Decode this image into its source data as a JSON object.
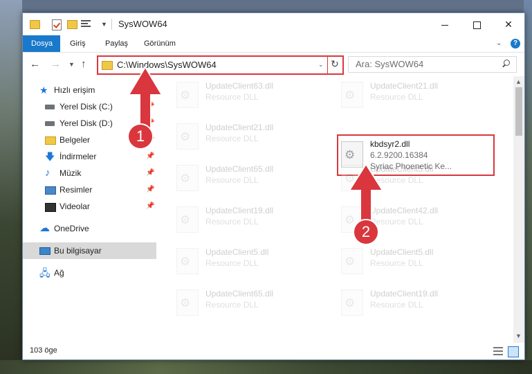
{
  "window": {
    "title": "SysWOW64",
    "min_label": "",
    "close_label": "✕"
  },
  "ribbon": {
    "tabs": [
      "Dosya",
      "Giriş",
      "Paylaş",
      "Görünüm"
    ],
    "help_label": "?"
  },
  "address": {
    "path": "C:\\Windows\\SysWOW64"
  },
  "search": {
    "placeholder": "Ara: SysWOW64"
  },
  "nav_pane": {
    "items": [
      {
        "label": "Hızlı erişim",
        "icon": "star-icon",
        "pinned": false
      },
      {
        "label": "Yerel Disk (C:)",
        "icon": "disk-icon",
        "pinned": true
      },
      {
        "label": "Yerel Disk (D:)",
        "icon": "disk-icon",
        "pinned": true
      },
      {
        "label": "Belgeler",
        "icon": "folder-icon",
        "pinned": true
      },
      {
        "label": "İndirmeler",
        "icon": "download-icon",
        "pinned": true
      },
      {
        "label": "Müzik",
        "icon": "music-icon",
        "pinned": true
      },
      {
        "label": "Resimler",
        "icon": "pictures-icon",
        "pinned": true
      },
      {
        "label": "Videolar",
        "icon": "video-icon",
        "pinned": true
      },
      {
        "label": "OneDrive",
        "icon": "cloud-icon",
        "pinned": false
      },
      {
        "label": "Bu bilgisayar",
        "icon": "computer-icon",
        "pinned": false,
        "selected": true
      },
      {
        "label": "Ağ",
        "icon": "network-icon",
        "pinned": false
      }
    ]
  },
  "files": {
    "left_column": [
      {
        "name": "UpdateClient63.dll",
        "desc": "Resource DLL"
      },
      {
        "name": "UpdateClient21.dll",
        "desc": "Resource DLL"
      },
      {
        "name": "UpdateClient65.dll",
        "desc": "Resource DLL"
      },
      {
        "name": "UpdateClient19.dll",
        "desc": "Resource DLL"
      },
      {
        "name": "UpdateClient5.dll",
        "desc": "Resource DLL"
      },
      {
        "name": "UpdateClient65.dll",
        "desc": "Resource DLL"
      }
    ],
    "right_column": [
      {
        "name": "UpdateClient21.dll",
        "desc": "Resource DLL"
      },
      {
        "name": "UpdateClient5.dll",
        "desc": "Resource DLL"
      },
      {
        "name": "UpdateClient42.dll",
        "desc": "Resource DLL"
      },
      {
        "name": "UpdateClient5.dll",
        "desc": "Resource DLL"
      },
      {
        "name": "UpdateClient19.dll",
        "desc": "Resource DLL"
      }
    ],
    "highlighted": {
      "name": "kbdsyr2.dll",
      "version": "6.2.9200.16384",
      "desc": "Syriac Phoenetic Ke..."
    }
  },
  "status": {
    "item_count": "103 öge"
  },
  "annotations": {
    "badge_1": "1",
    "badge_2": "2",
    "accent_color": "#d9363e"
  }
}
